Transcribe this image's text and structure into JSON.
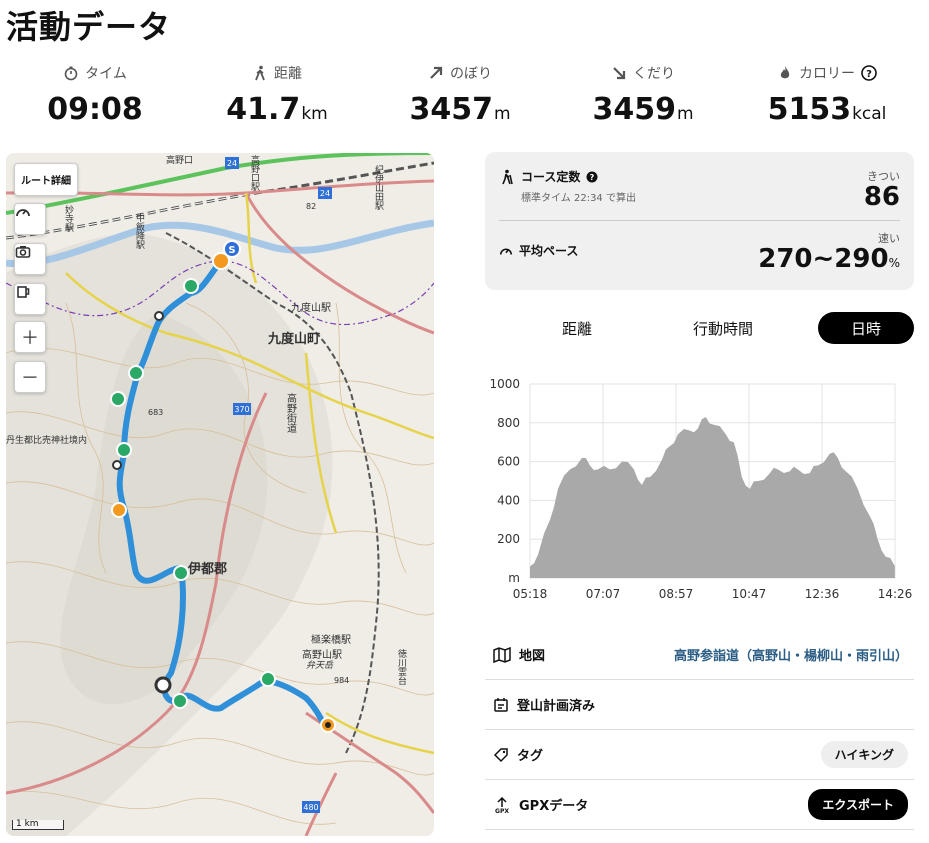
{
  "page": {
    "title": "活動データ"
  },
  "stats": [
    {
      "label": "タイム",
      "value": "09:08",
      "unit": "",
      "icon": "stopwatch-icon"
    },
    {
      "label": "距離",
      "value": "41.7",
      "unit": "km",
      "icon": "walker-icon"
    },
    {
      "label": "のぼり",
      "value": "3457",
      "unit": "m",
      "icon": "arrow-up-right-icon"
    },
    {
      "label": "くだり",
      "value": "3459",
      "unit": "m",
      "icon": "arrow-down-right-icon"
    },
    {
      "label": "カロリー",
      "value": "5153",
      "unit": "kcal",
      "icon": "flame-icon"
    }
  ],
  "map": {
    "route_button": "ルート詳細",
    "scale": "1 km",
    "labels": {
      "town": "九度山町",
      "district": "伊都郡",
      "station_kudoyama": "九度山駅",
      "station_gokurakubashi": "極楽橋駅",
      "station_koyasan": "高野山駅",
      "shrine": "丹生都比売神社境内",
      "road_koya": "高野街道",
      "benten": "弁天岳",
      "elev_683": "683",
      "elev_984": "984",
      "elev_82": "82",
      "route_370": "370",
      "route_480": "480",
      "route_24a": "24",
      "route_24b": "24",
      "tokugawa": "徳川霊台",
      "kiiiyama": "紀伊山田駅",
      "myoji": "妙寺駅",
      "nakaiide": "中飯降駅",
      "koyaguchi": "高野口",
      "koyaguchi_sta": "高野口駅"
    },
    "accent_route": "#2f8fd8"
  },
  "course": {
    "constant_label": "コース定数",
    "standard_time": "標準タイム 22:34 で算出",
    "difficulty_tag": "きつい",
    "difficulty_value": "86",
    "pace_label": "平均ペース",
    "pace_tag": "速い",
    "pace_value": "270~290",
    "pace_unit": "%"
  },
  "tabs": [
    {
      "label": "距離",
      "active": false
    },
    {
      "label": "行動時間",
      "active": false
    },
    {
      "label": "日時",
      "active": true
    }
  ],
  "chart_data": {
    "type": "area",
    "ylabel": "m",
    "ylim": [
      0,
      1000
    ],
    "yticks": [
      0,
      200,
      400,
      600,
      800,
      1000
    ],
    "xticks": [
      "05:18",
      "07:07",
      "08:57",
      "10:47",
      "12:36",
      "14:26"
    ],
    "x_hours": [
      5.3,
      5.5,
      5.8,
      6.0,
      6.3,
      6.6,
      6.8,
      7.0,
      7.3,
      7.6,
      7.9,
      8.1,
      8.3,
      8.6,
      8.8,
      9.0,
      9.3,
      9.5,
      9.7,
      9.9,
      10.2,
      10.4,
      10.6,
      10.8,
      11.0,
      11.3,
      11.5,
      11.8,
      12.0,
      12.3,
      12.5,
      12.8,
      13.0,
      13.2,
      13.5,
      13.8,
      14.0,
      14.2,
      14.43
    ],
    "values": [
      60,
      120,
      300,
      460,
      560,
      620,
      580,
      560,
      560,
      600,
      560,
      480,
      520,
      610,
      680,
      740,
      760,
      770,
      830,
      790,
      740,
      700,
      520,
      460,
      500,
      540,
      560,
      550,
      560,
      540,
      580,
      640,
      620,
      550,
      460,
      320,
      200,
      110,
      60
    ],
    "fill": "#a9a9a9"
  },
  "rows": [
    {
      "label": "地図",
      "icon": "map-icon",
      "link": "高野参詣道（高野山・楊柳山・雨引山）"
    },
    {
      "label": "登山計画済み",
      "icon": "calendar-icon"
    },
    {
      "label": "タグ",
      "icon": "tag-icon",
      "pill": "ハイキング"
    },
    {
      "label": "GPXデータ",
      "icon": "gpx-export-icon",
      "button": "エクスポート"
    }
  ]
}
